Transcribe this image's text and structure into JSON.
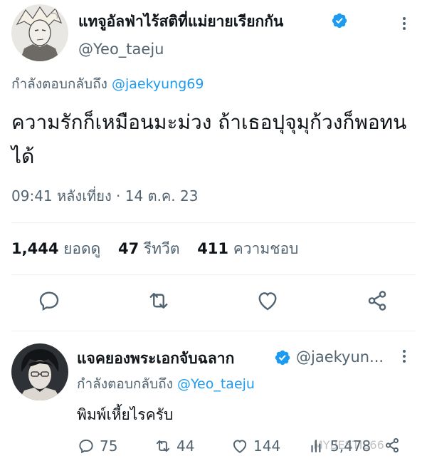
{
  "main_tweet": {
    "display_name": "แทจูอัลฟ่าไร้สติที่แม่ยายเรียกกัน",
    "handle": "@Yeo_taeju",
    "reply_prefix": "กำลังตอบกลับถึง",
    "reply_mention": "@jaekyung69",
    "text": "ความรักก็เหมือนมะม่วง ถ้าเธอปุจุมุก้วงก็พอทนได้",
    "timestamp": "09:41 หลังเที่ยง · 14 ต.ค. 23",
    "stats": {
      "views_count": "1,444",
      "views_label": "ยอดดู",
      "retweets_count": "47",
      "retweets_label": "รีทวีต",
      "likes_count": "411",
      "likes_label": "ความชอบ"
    }
  },
  "reply_tweet": {
    "display_name": "แจคยองพระเอกจับฉลาก",
    "handle": "@jaekyun...",
    "reply_prefix": "กำลังตอบกลับถึง",
    "reply_mention": "@Yeo_taeju",
    "text": "พิมพ์เหี้ยไรครับ",
    "actions": {
      "replies": "75",
      "retweets": "44",
      "likes": "144",
      "views": "5,478"
    }
  },
  "watermark": "MYBESTIE66",
  "colors": {
    "accent": "#1d9bf0",
    "secondary_text": "#536471",
    "primary_text": "#0f1419",
    "divider": "#eff3f4"
  },
  "icons": [
    "verified-badge-icon",
    "more-options-icon",
    "reply-icon",
    "retweet-icon",
    "like-icon",
    "share-icon",
    "views-icon"
  ]
}
